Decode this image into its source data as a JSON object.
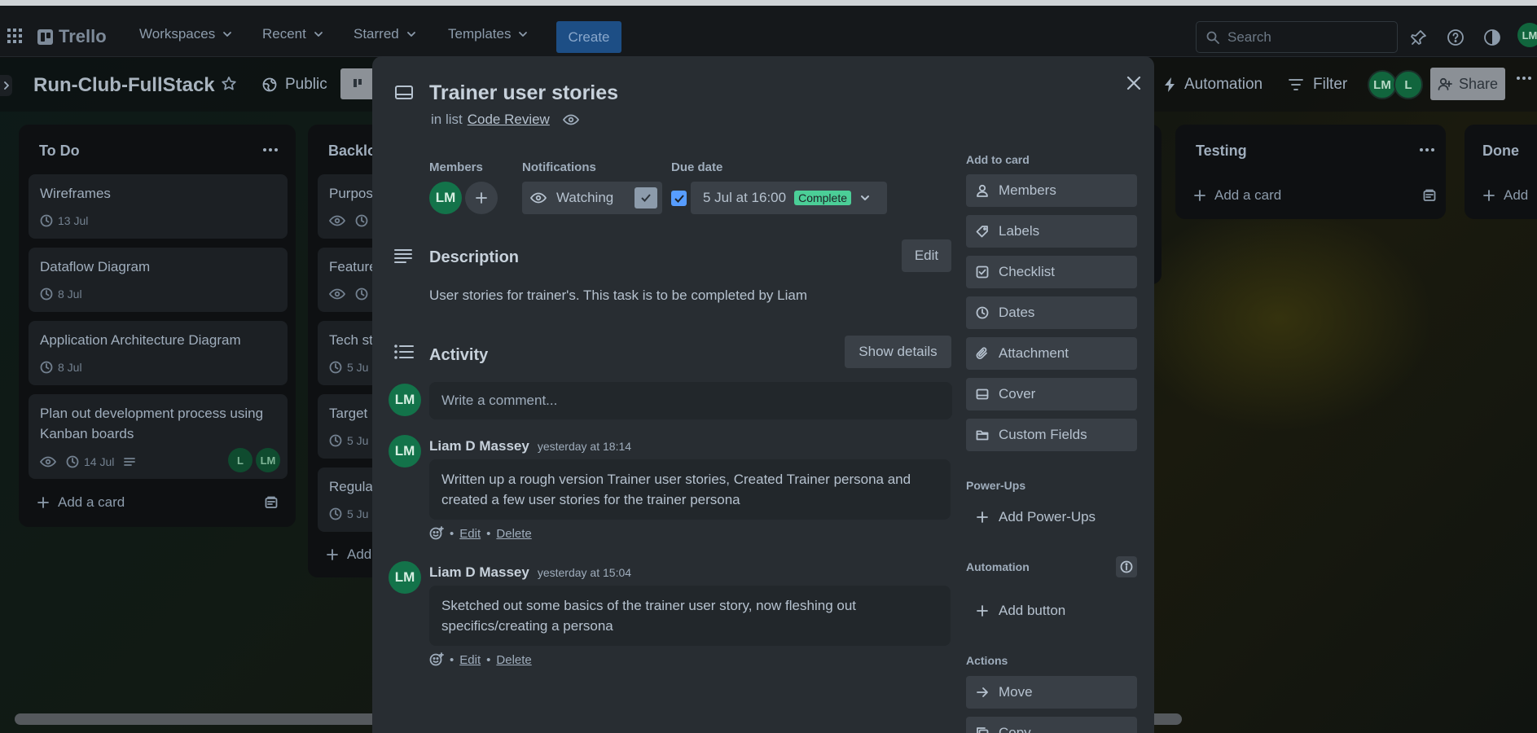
{
  "topbar": {
    "logo": "Trello",
    "menu": [
      "Workspaces",
      "Recent",
      "Starred",
      "Templates"
    ],
    "create_label": "Create",
    "search_placeholder": "Search",
    "avatar": "LM"
  },
  "board": {
    "title": "Run-Club-FullStack",
    "visibility": "Public",
    "automation": "Automation",
    "filter": "Filter",
    "members": [
      "LM",
      "L"
    ],
    "share": "Share"
  },
  "lists": [
    {
      "title": "To Do",
      "cards": [
        {
          "title": "Wireframes",
          "date": "13 Jul"
        },
        {
          "title": "Dataflow Diagram",
          "date": "8 Jul"
        },
        {
          "title": "Application Architecture Diagram",
          "date": "8 Jul"
        },
        {
          "title": "Plan out development process using Kanban boards",
          "date": "14 Jul",
          "members": [
            "L",
            "LM"
          ]
        }
      ],
      "add_card": "Add a card"
    },
    {
      "title": "Backlog",
      "cards": [
        {
          "title": "Purpose"
        },
        {
          "title": "Feature"
        },
        {
          "title": "Tech st",
          "date": "5 Ju"
        },
        {
          "title": "Target",
          "date": "5 Ju"
        },
        {
          "title": "Regula",
          "date": "5 Ju"
        }
      ],
      "add_card": "Add"
    },
    {
      "title": "Testing",
      "add_card": "Add a card"
    },
    {
      "title": "Done",
      "add_card": "Add"
    }
  ],
  "modal": {
    "card_title": "Trainer user stories",
    "in_list_prefix": "in list",
    "list_name": "Code Review",
    "members_label": "Members",
    "member_avatar": "LM",
    "notifications_label": "Notifications",
    "watching_label": "Watching",
    "due_label": "Due date",
    "due_value": "5 Jul at 16:00",
    "due_status": "Complete",
    "description_title": "Description",
    "edit_label": "Edit",
    "description_text": "User stories for trainer's. This task is to be completed by Liam",
    "activity_title": "Activity",
    "show_details": "Show details",
    "comment_placeholder": "Write a comment...",
    "user_avatar": "LM",
    "comments": [
      {
        "avatar": "LM",
        "author": "Liam D Massey",
        "time": "yesterday at 18:14",
        "text": "Written up a rough version Trainer user stories, Created Trainer persona and created a few user stories for the trainer persona",
        "edit": "Edit",
        "delete": "Delete"
      },
      {
        "avatar": "LM",
        "author": "Liam D Massey",
        "time": "yesterday at 15:04",
        "text": "Sketched out some basics of the trainer user story, now fleshing out specifics/creating a persona",
        "edit": "Edit",
        "delete": "Delete"
      }
    ],
    "sidebar": {
      "add_to_card": "Add to card",
      "add_items": [
        "Members",
        "Labels",
        "Checklist",
        "Dates",
        "Attachment",
        "Cover",
        "Custom Fields"
      ],
      "powerups_head": "Power-Ups",
      "add_powerups": "Add Power-Ups",
      "automation_head": "Automation",
      "add_button": "Add button",
      "actions_head": "Actions",
      "move": "Move",
      "copy": "Copy"
    }
  }
}
